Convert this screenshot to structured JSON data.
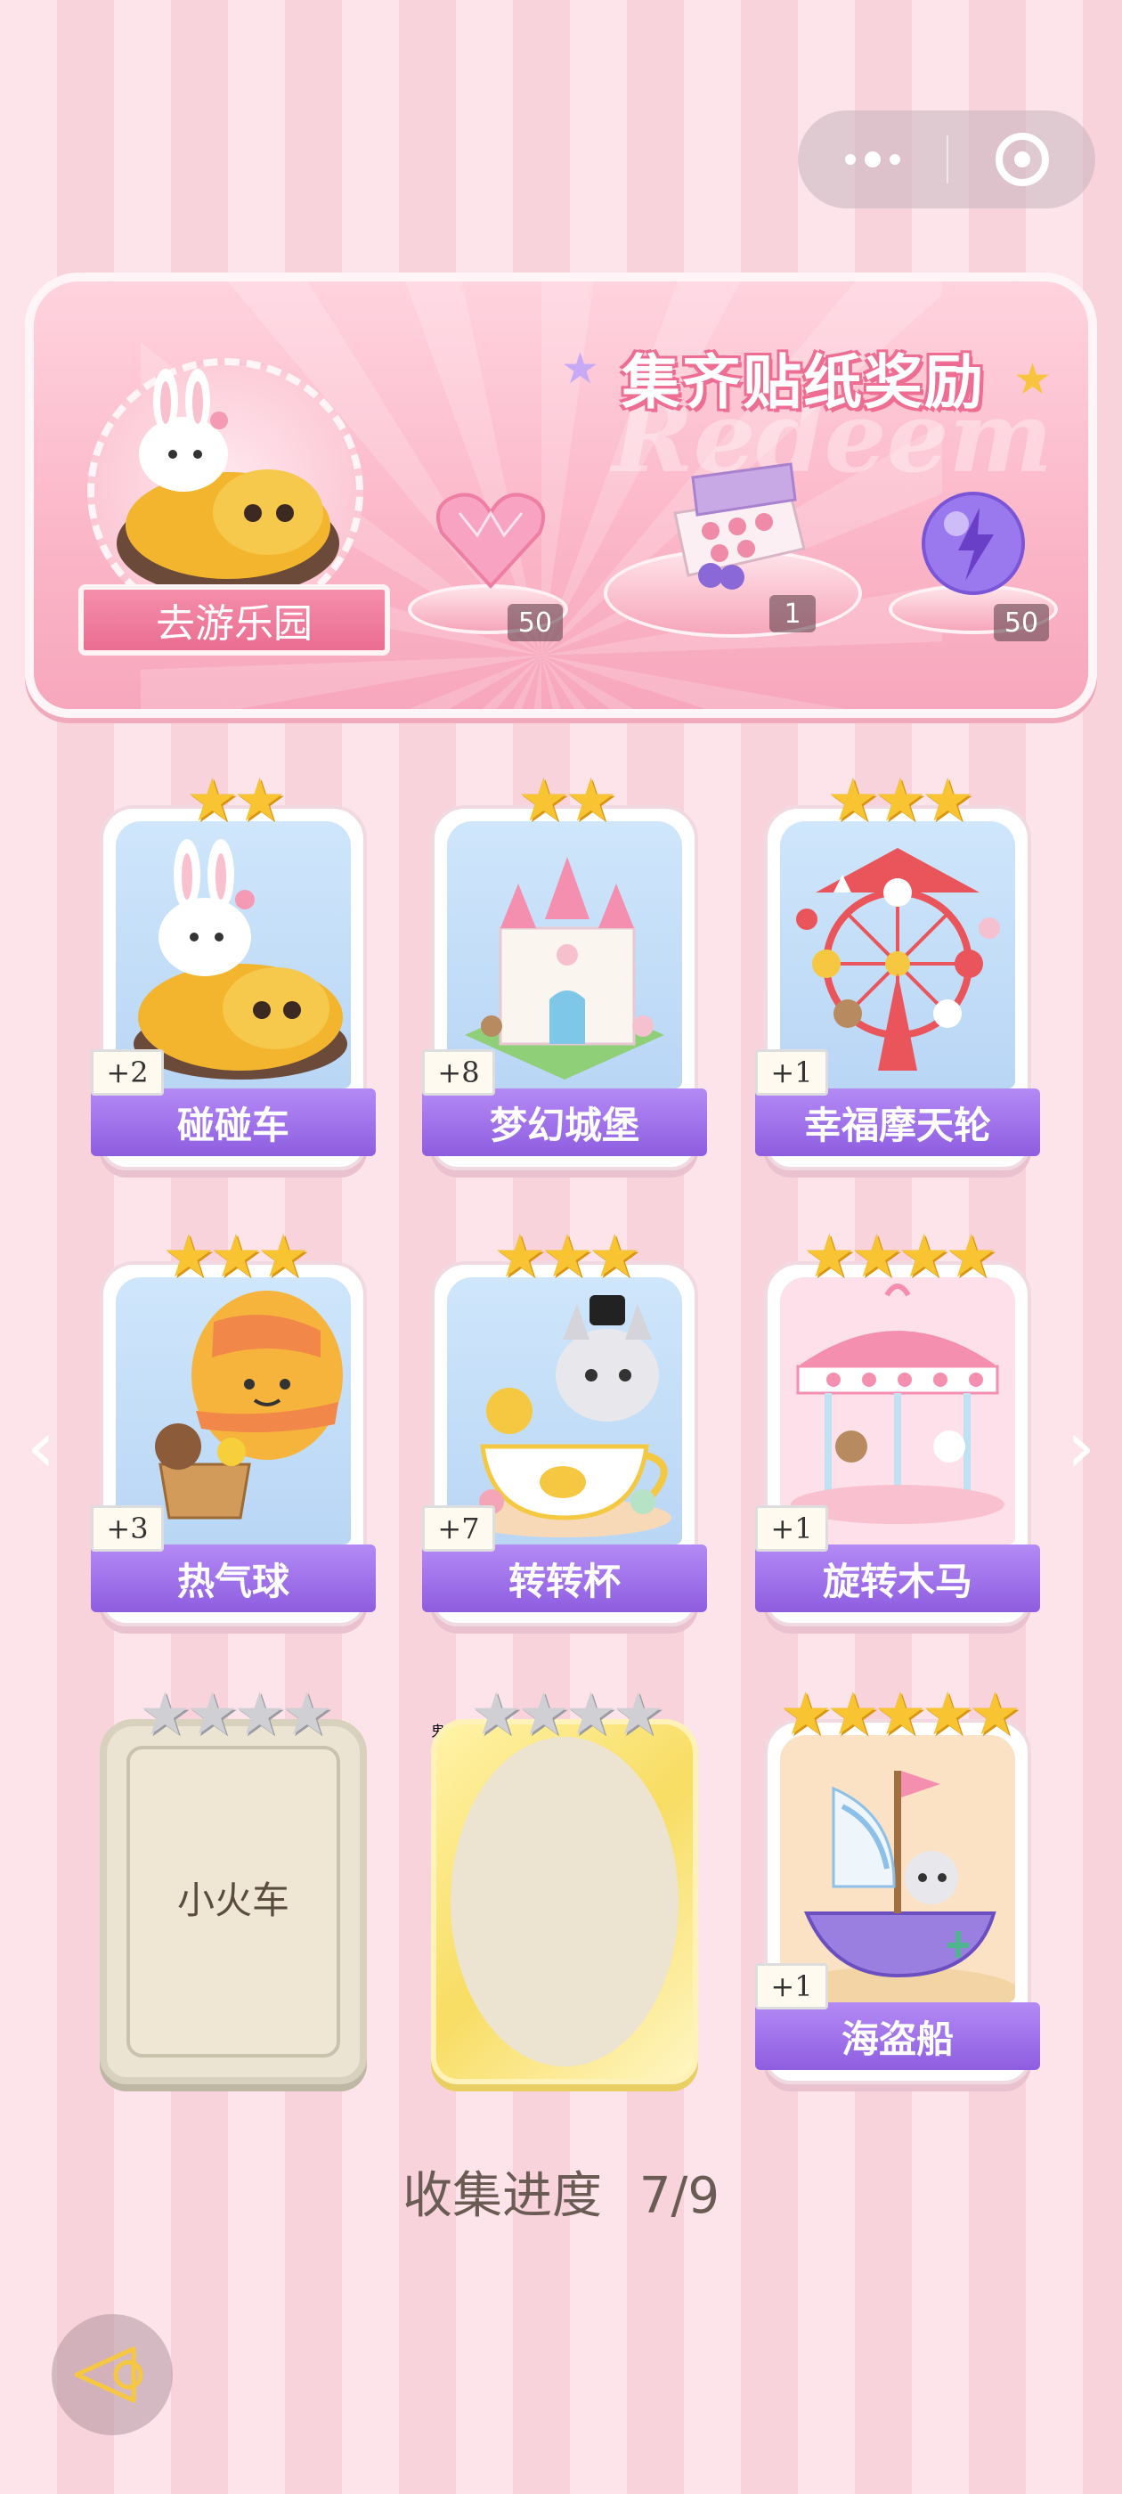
{
  "capsule": {
    "more_icon": "more-dots-icon",
    "close_icon": "target-circle-icon"
  },
  "banner": {
    "title": "集齐贴纸奖励",
    "watermark": "Redeem",
    "enter_button": "去游乐园",
    "rewards": [
      {
        "icon": "pink-heart-gem-icon",
        "count": "50"
      },
      {
        "icon": "gift-box-icon",
        "count": "1"
      },
      {
        "icon": "lightning-orb-icon",
        "count": "50"
      }
    ]
  },
  "cards": [
    {
      "name": "碰碰车",
      "stars": 2,
      "stars_filled": 2,
      "plus": "+2",
      "collected": true,
      "art": "bumper-car"
    },
    {
      "name": "梦幻城堡",
      "stars": 2,
      "stars_filled": 2,
      "plus": "+8",
      "collected": true,
      "art": "castle"
    },
    {
      "name": "幸福摩天轮",
      "stars": 3,
      "stars_filled": 3,
      "plus": "+1",
      "collected": true,
      "art": "ferris-wheel"
    },
    {
      "name": "热气球",
      "stars": 3,
      "stars_filled": 3,
      "plus": "+3",
      "collected": true,
      "art": "hot-air-balloon"
    },
    {
      "name": "转转杯",
      "stars": 3,
      "stars_filled": 3,
      "plus": "+7",
      "collected": true,
      "art": "teacup"
    },
    {
      "name": "旋转木马",
      "stars": 4,
      "stars_filled": 4,
      "plus": "+1",
      "collected": true,
      "art": "carousel"
    },
    {
      "name": "小火车",
      "stars": 4,
      "stars_filled": 0,
      "plus": "",
      "collected": false,
      "art": "locked"
    },
    {
      "name": "鬼屋大冒险",
      "stars": 4,
      "stars_filled": 0,
      "plus": "",
      "collected": false,
      "art": "locked-gold"
    },
    {
      "name": "海盗船",
      "stars": 5,
      "stars_filled": 5,
      "plus": "+1",
      "collected": true,
      "art": "pirate-ship"
    }
  ],
  "progress": {
    "label": "收集进度",
    "value": "7/9"
  },
  "nav": {
    "prev_icon": "chevron-left-icon",
    "next_icon": "chevron-right-icon",
    "back_icon": "back-arrow-icon"
  },
  "colors": {
    "label_purple": "#9a6be6",
    "gold_star": "#f9c431",
    "pink_accent": "#ea6d91"
  }
}
